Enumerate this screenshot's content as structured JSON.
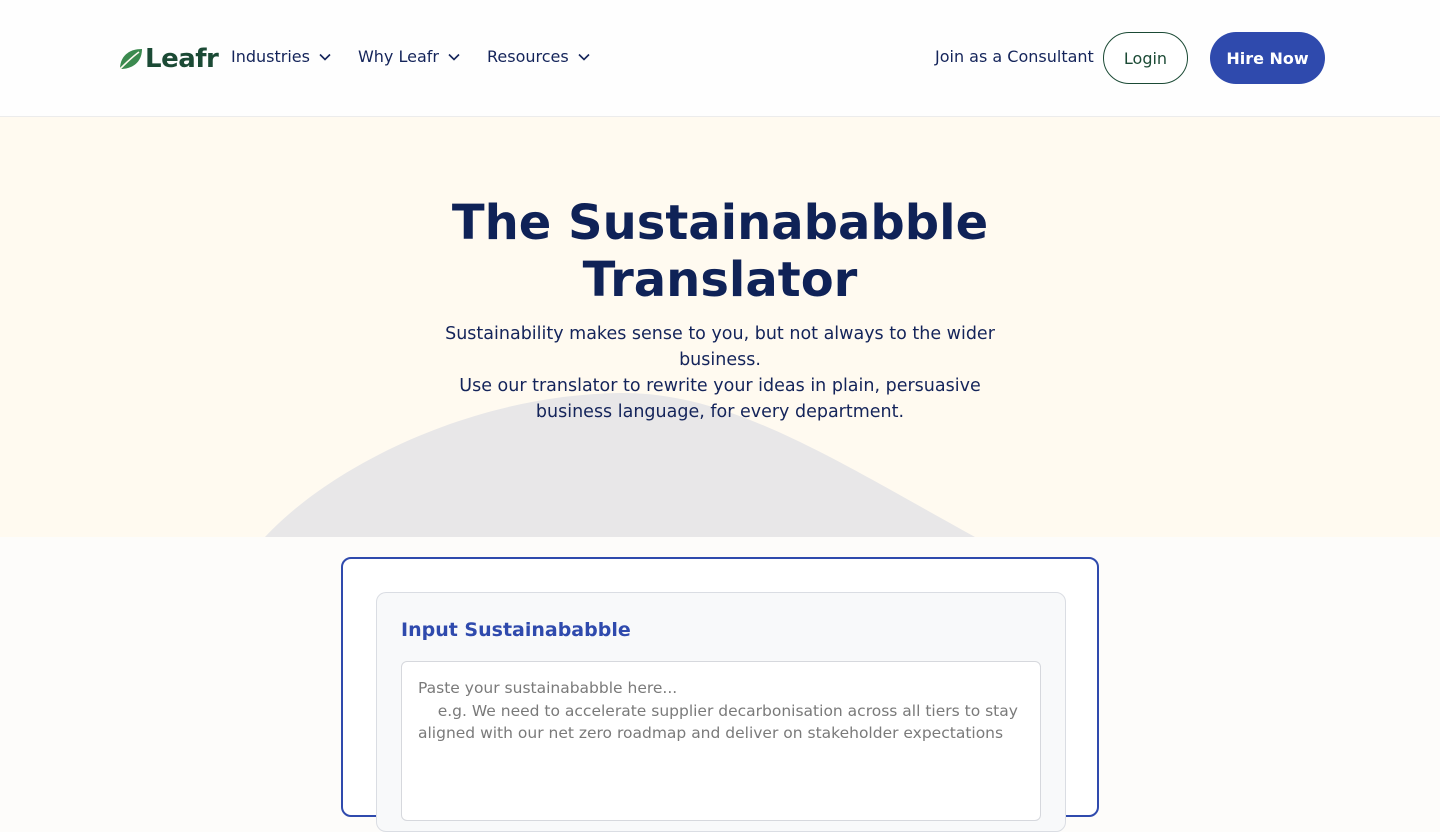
{
  "header": {
    "logo_text": "Leafr",
    "nav": [
      {
        "label": "Industries"
      },
      {
        "label": "Why Leafr"
      },
      {
        "label": "Resources"
      }
    ],
    "consultant_link": "Join as a Consultant",
    "login_label": "Login",
    "hire_label": "Hire Now"
  },
  "hero": {
    "title": "The Sustainababble Translator",
    "subtitle_line1": "Sustainability makes sense to you, but not always to the wider business.",
    "subtitle_line2": "Use our translator to rewrite your ideas in plain, persuasive business language, for every department."
  },
  "translator": {
    "input_title": "Input Sustainababble",
    "placeholder": "Paste your sustainababble here...\n    e.g. We need to accelerate supplier decarbonisation across all tiers to stay aligned with our net zero roadmap and deliver on stakeholder expectations"
  },
  "colors": {
    "brand_blue": "#2f4aad",
    "brand_green": "#1b4a35",
    "navy_text": "#0f2257",
    "hero_bg": "#fffaf0"
  },
  "icons": {
    "logo": "leaf-icon",
    "nav_dropdown": "chevron-down-icon"
  }
}
